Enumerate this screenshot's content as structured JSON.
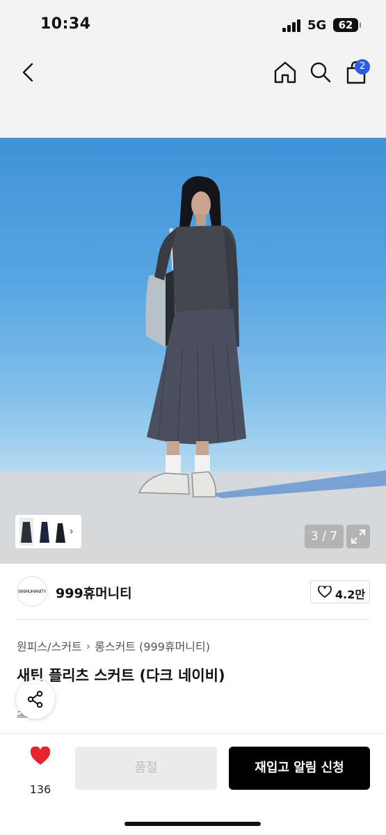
{
  "status_bar": {
    "time": "10:34",
    "network": "5G",
    "battery": "62"
  },
  "nav": {
    "cart_badge": "2"
  },
  "gallery": {
    "counter": "3 / 7",
    "colors": {
      "sky": "#4a9bdc",
      "ground": "#d6d8da"
    }
  },
  "brand": {
    "logo_text": "999HUMANITY",
    "name": "999휴머니티",
    "likes": "4.2만"
  },
  "breadcrumb": {
    "items": [
      "원피스/스커트",
      "롱스커트 (999휴머니티)"
    ]
  },
  "product": {
    "title": "새틴 플리츠 스커트 (다크 네이비)",
    "sub_link": "소개"
  },
  "bottom_bar": {
    "like_count": "136",
    "soldout_label": "품절",
    "restock_label": "재입고 알림 신청"
  },
  "colors": {
    "accent": "#2d5be3",
    "like_red": "#e8232e",
    "black": "#000000"
  }
}
